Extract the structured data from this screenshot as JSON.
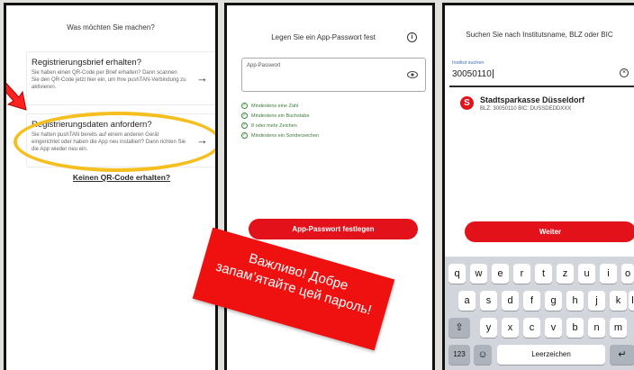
{
  "screen1": {
    "title": "Was möchten Sie machen?",
    "option1": {
      "title": "Registrierungsbrief erhalten?",
      "description": "Sie haben einen QR-Code per Brief erhalten? Dann scannen Sie den QR-Code jetzt hier ein, um Ihre pushTAN-Verbindung zu aktivieren."
    },
    "option2": {
      "title": "Registrierungsdaten anfordern?",
      "description": "Sie hatten pushTAN bereits auf einem anderen Gerät eingerichtet oder haben die App neu installiert? Dann richten Sie die App wieder neu ein."
    },
    "arrow_glyph": "→",
    "link": "Keinen QR-Code erhalten?",
    "highlight_color": "#f5bf1f"
  },
  "screen2": {
    "title": "Legen Sie ein App-Passwort fest",
    "info_glyph": "i",
    "field_label": "App-Passwort",
    "rules": [
      "Mindestens eine Zahl",
      "Mindestens ein Buchstabe",
      "8 oder mehr Zeichen",
      "Mindestens ein Sonderzeichen"
    ],
    "check_glyph": "✓",
    "button": "App-Passwort festlegen"
  },
  "screen3": {
    "title": "Suchen Sie nach Institutsname, BLZ oder BIC",
    "search_label": "Institut suchen",
    "search_value": "30050110",
    "clear_glyph": "×",
    "result": {
      "logo_glyph": "S",
      "name": "Stadtsparkasse Düsseldorf",
      "meta": "BLZ: 30050110    BIC: DUSSDEDDXXX"
    },
    "button": "Weiter",
    "keyboard": {
      "row1": [
        "q",
        "w",
        "e",
        "r",
        "t",
        "z",
        "u",
        "i",
        "o"
      ],
      "row2": [
        "a",
        "s",
        "d",
        "f",
        "g",
        "h",
        "j",
        "k",
        "l"
      ],
      "row3": [
        "y",
        "x",
        "c",
        "v",
        "b",
        "n",
        "m"
      ],
      "shift_glyph": "⇧",
      "numbers_key": "123",
      "emoji_glyph": "☺",
      "space_key": "Leerzeichen",
      "return_glyph": "↵"
    }
  },
  "banner": {
    "text": "Важливо! Добре запам’ятайте цей пароль!",
    "color": "#ef1010"
  },
  "brand_color": "#e3111a"
}
